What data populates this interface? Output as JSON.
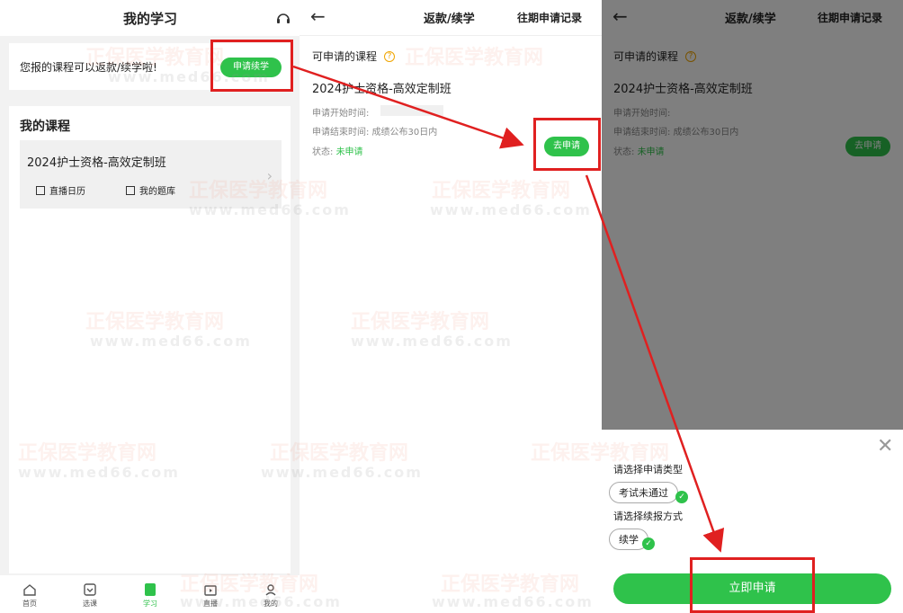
{
  "panel1": {
    "title": "我的学习",
    "banner_text": "您报的课程可以返款/续学啦!",
    "apply_button": "申请续学",
    "section_title": "我的课程",
    "course_title": "2024护士资格-高效定制班",
    "links": [
      "直播日历",
      "我的题库"
    ],
    "tabs": [
      {
        "label": "首页",
        "icon": "home-icon"
      },
      {
        "label": "选课",
        "icon": "course-select-icon"
      },
      {
        "label": "学习",
        "icon": "study-icon"
      },
      {
        "label": "直播",
        "icon": "live-icon"
      },
      {
        "label": "我的",
        "icon": "profile-icon"
      }
    ]
  },
  "panel2": {
    "title": "返款/续学",
    "history_link": "往期申请记录",
    "section_label": "可申请的课程",
    "course_title": "2024护士资格-高效定制班",
    "start_label": "申请开始时间:",
    "end_label": "申请结束时间: 成绩公布30日内",
    "status_label": "状态:",
    "status_value": "未申请",
    "apply_button": "去申请"
  },
  "panel3": {
    "title": "返款/续学",
    "history_link": "往期申请记录",
    "section_label": "可申请的课程",
    "course_title": "2024护士资格-高效定制班",
    "start_label": "申请开始时间:",
    "end_label": "申请结束时间: 成绩公布30日内",
    "status_label": "状态:",
    "status_value": "未申请",
    "apply_button": "去申请",
    "sheet_label1": "请选择申请类型",
    "option1": "考试未通过",
    "sheet_label2": "请选择续报方式",
    "option2": "续学",
    "submit_button": "立即申请"
  },
  "watermark": {
    "brand": "正保医学教育网",
    "url": "www.med66.com"
  },
  "colors": {
    "accent": "#2fc24b",
    "annotation": "#e02020"
  }
}
